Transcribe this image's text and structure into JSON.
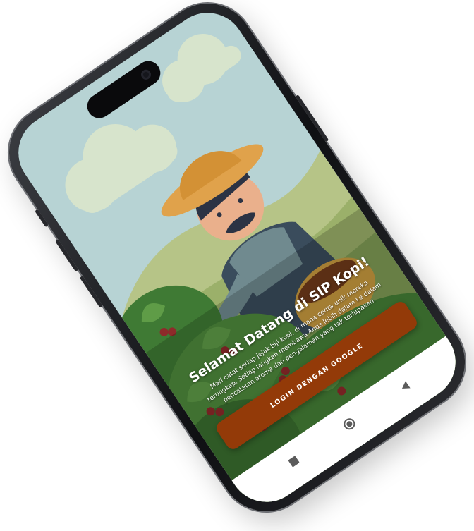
{
  "app": {
    "welcome_title": "Selamat Datang di SIP Kopi!",
    "description": "Mari catat setiap jejak biji kopi, di mana cerita unik mereka terungkap. Setiap langkah membawa Anda lebih dalam ke dalam pencatatan aroma dan pengalaman yang tak terlupakan.",
    "login_button_label": "LOGIN DENGAN GOOGLE"
  },
  "colors": {
    "accent": "#933a08",
    "sky": "#b7d3d4",
    "hat": "#e0a24b",
    "leaf": "#4f8a3c",
    "cherry": "#8e2a2a"
  },
  "navbar": {
    "items": [
      {
        "icon": "recent-apps-square-icon"
      },
      {
        "icon": "home-circle-icon"
      },
      {
        "icon": "back-triangle-icon"
      }
    ]
  }
}
